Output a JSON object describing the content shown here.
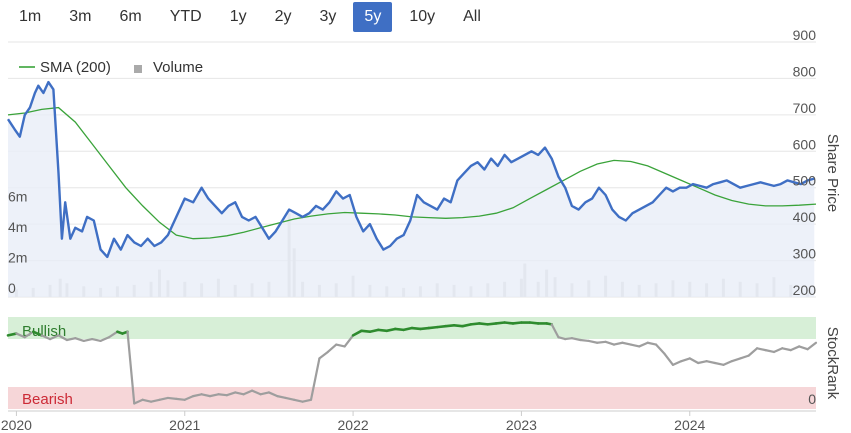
{
  "range_selector": {
    "buttons": [
      "1m",
      "3m",
      "6m",
      "YTD",
      "1y",
      "2y",
      "3y",
      "5y",
      "10y",
      "All"
    ],
    "active": "5y"
  },
  "colors": {
    "price": "#3f6fc4",
    "sma": "#3aa33a",
    "volume": "#cccccc",
    "stockrank": "#9e9e9e",
    "stockrank_bullish": "#2e8b2e",
    "bullish_band": "#d7efd7",
    "bearish_band": "#f6d6d8",
    "bullish_text": "#2e7d2e",
    "bearish_text": "#cc2a36"
  },
  "chart_data": [
    {
      "type": "line",
      "title": "",
      "ylabel": "Share Price",
      "ylim": [
        200,
        900
      ],
      "yticks": [
        "900",
        "800",
        "700",
        "600",
        "500",
        "400",
        "300",
        "200"
      ],
      "volume_ticks": [
        "6m",
        "4m",
        "2m",
        "0"
      ],
      "volume_ylim": [
        0,
        9
      ],
      "xlim": [
        2019.95,
        2024.75
      ],
      "xticks": [
        "2020",
        "2021",
        "2022",
        "2023",
        "2024"
      ],
      "legend": [
        "SMA (200)",
        "Volume"
      ],
      "legend_position": "top-left",
      "series": [
        {
          "name": "Price",
          "x": [
            2019.95,
            2019.99,
            2020.02,
            2020.05,
            2020.08,
            2020.11,
            2020.13,
            2020.16,
            2020.19,
            2020.22,
            2020.25,
            2020.27,
            2020.29,
            2020.32,
            2020.35,
            2020.39,
            2020.42,
            2020.46,
            2020.5,
            2020.54,
            2020.58,
            2020.62,
            2020.66,
            2020.7,
            2020.74,
            2020.78,
            2020.82,
            2020.86,
            2020.9,
            2020.95,
            2021.0,
            2021.05,
            2021.1,
            2021.14,
            2021.18,
            2021.22,
            2021.26,
            2021.3,
            2021.34,
            2021.38,
            2021.42,
            2021.46,
            2021.5,
            2021.54,
            2021.58,
            2021.62,
            2021.66,
            2021.7,
            2021.74,
            2021.78,
            2021.82,
            2021.86,
            2021.9,
            2021.94,
            2021.98,
            2022.02,
            2022.06,
            2022.1,
            2022.14,
            2022.18,
            2022.22,
            2022.26,
            2022.3,
            2022.34,
            2022.38,
            2022.42,
            2022.46,
            2022.5,
            2022.54,
            2022.58,
            2022.62,
            2022.66,
            2022.7,
            2022.74,
            2022.78,
            2022.82,
            2022.86,
            2022.9,
            2022.94,
            2022.98,
            2023.02,
            2023.06,
            2023.1,
            2023.14,
            2023.18,
            2023.22,
            2023.26,
            2023.3,
            2023.34,
            2023.38,
            2023.42,
            2023.46,
            2023.5,
            2023.54,
            2023.58,
            2023.62,
            2023.66,
            2023.7,
            2023.74,
            2023.78,
            2023.82,
            2023.86,
            2023.9,
            2023.94,
            2023.98,
            2024.02,
            2024.06,
            2024.1,
            2024.14,
            2024.18,
            2024.22,
            2024.26,
            2024.3,
            2024.34,
            2024.38,
            2024.42,
            2024.46,
            2024.5,
            2024.54,
            2024.58,
            2024.62,
            2024.66,
            2024.7,
            2024.74
          ],
          "values": [
            688,
            660,
            640,
            700,
            720,
            760,
            780,
            760,
            790,
            770,
            540,
            360,
            460,
            360,
            390,
            380,
            420,
            410,
            330,
            310,
            360,
            330,
            370,
            350,
            340,
            360,
            340,
            350,
            370,
            420,
            470,
            460,
            500,
            470,
            450,
            430,
            450,
            460,
            420,
            410,
            420,
            390,
            360,
            380,
            410,
            440,
            430,
            420,
            430,
            450,
            440,
            460,
            490,
            470,
            480,
            420,
            380,
            400,
            360,
            330,
            340,
            360,
            370,
            410,
            480,
            460,
            450,
            440,
            470,
            460,
            520,
            540,
            560,
            570,
            550,
            580,
            560,
            590,
            570,
            580,
            590,
            600,
            590,
            610,
            580,
            530,
            500,
            450,
            440,
            460,
            470,
            500,
            480,
            440,
            420,
            410,
            430,
            440,
            450,
            460,
            480,
            500,
            490,
            500,
            500,
            510,
            505,
            500,
            510,
            515,
            520,
            510,
            500,
            505,
            510,
            515,
            510,
            505,
            510,
            520,
            515,
            510,
            520,
            525
          ]
        },
        {
          "name": "SMA (200)",
          "x": [
            2019.95,
            2020.05,
            2020.15,
            2020.25,
            2020.35,
            2020.45,
            2020.55,
            2020.65,
            2020.75,
            2020.85,
            2020.95,
            2021.05,
            2021.15,
            2021.25,
            2021.35,
            2021.45,
            2021.55,
            2021.65,
            2021.75,
            2021.85,
            2021.95,
            2022.05,
            2022.15,
            2022.25,
            2022.35,
            2022.45,
            2022.55,
            2022.65,
            2022.75,
            2022.85,
            2022.95,
            2023.05,
            2023.15,
            2023.25,
            2023.35,
            2023.45,
            2023.55,
            2023.65,
            2023.75,
            2023.85,
            2023.95,
            2024.05,
            2024.15,
            2024.25,
            2024.35,
            2024.45,
            2024.55,
            2024.65,
            2024.75
          ],
          "values": [
            700,
            705,
            715,
            720,
            680,
            620,
            560,
            500,
            450,
            405,
            370,
            360,
            362,
            368,
            378,
            390,
            402,
            414,
            422,
            428,
            432,
            430,
            428,
            425,
            420,
            418,
            416,
            418,
            422,
            430,
            445,
            470,
            495,
            520,
            545,
            565,
            575,
            572,
            560,
            540,
            520,
            500,
            480,
            465,
            455,
            450,
            450,
            452,
            455
          ]
        },
        {
          "name": "Volume",
          "type": "bar",
          "x": [
            2020.0,
            2020.1,
            2020.2,
            2020.26,
            2020.3,
            2020.4,
            2020.5,
            2020.6,
            2020.7,
            2020.8,
            2020.85,
            2020.9,
            2021.0,
            2021.1,
            2021.2,
            2021.3,
            2021.4,
            2021.5,
            2021.62,
            2021.65,
            2021.7,
            2021.8,
            2021.9,
            2022.0,
            2022.1,
            2022.2,
            2022.3,
            2022.4,
            2022.5,
            2022.6,
            2022.7,
            2022.8,
            2022.9,
            2023.0,
            2023.02,
            2023.1,
            2023.15,
            2023.2,
            2023.3,
            2023.4,
            2023.5,
            2023.6,
            2023.7,
            2023.8,
            2023.9,
            2024.0,
            2024.1,
            2024.2,
            2024.3,
            2024.4,
            2024.5,
            2024.6,
            2024.7
          ],
          "values": [
            0.5,
            0.6,
            0.8,
            1.2,
            0.9,
            0.7,
            0.6,
            0.7,
            0.8,
            1.0,
            1.8,
            1.1,
            1.0,
            0.9,
            1.2,
            0.8,
            0.9,
            1.0,
            5.5,
            3.2,
            1.0,
            0.8,
            0.9,
            1.4,
            0.8,
            0.7,
            0.6,
            0.7,
            0.9,
            0.8,
            0.7,
            0.9,
            1.0,
            1.2,
            2.2,
            1.0,
            1.8,
            1.3,
            0.9,
            1.1,
            1.4,
            1.0,
            0.8,
            0.9,
            1.1,
            1.0,
            0.9,
            1.2,
            1.0,
            0.9,
            1.3,
            0.8,
            0.6
          ]
        }
      ]
    },
    {
      "type": "line",
      "title": "",
      "ylabel": "StockRank",
      "ylim": [
        0,
        100
      ],
      "yticks": [
        "100",
        "0"
      ],
      "bands": [
        "Bullish",
        "Bearish"
      ],
      "series": [
        {
          "name": "StockRank",
          "x": [
            2019.95,
            2020.0,
            2020.05,
            2020.1,
            2020.15,
            2020.2,
            2020.25,
            2020.3,
            2020.35,
            2020.4,
            2020.45,
            2020.5,
            2020.55,
            2020.6,
            2020.63,
            2020.66,
            2020.7,
            2020.75,
            2020.8,
            2020.85,
            2020.9,
            2020.95,
            2021.0,
            2021.05,
            2021.1,
            2021.15,
            2021.2,
            2021.25,
            2021.3,
            2021.35,
            2021.4,
            2021.45,
            2021.5,
            2021.55,
            2021.6,
            2021.65,
            2021.7,
            2021.75,
            2021.8,
            2021.85,
            2021.9,
            2021.95,
            2022.0,
            2022.05,
            2022.1,
            2022.15,
            2022.2,
            2022.25,
            2022.3,
            2022.35,
            2022.4,
            2022.45,
            2022.5,
            2022.55,
            2022.6,
            2022.65,
            2022.7,
            2022.75,
            2022.8,
            2022.85,
            2022.9,
            2022.95,
            2023.0,
            2023.05,
            2023.1,
            2023.15,
            2023.18,
            2023.22,
            2023.26,
            2023.3,
            2023.35,
            2023.4,
            2023.45,
            2023.5,
            2023.55,
            2023.6,
            2023.65,
            2023.7,
            2023.75,
            2023.8,
            2023.85,
            2023.9,
            2023.95,
            2024.0,
            2024.05,
            2024.1,
            2024.15,
            2024.2,
            2024.25,
            2024.3,
            2024.35,
            2024.4,
            2024.45,
            2024.5,
            2024.55,
            2024.6,
            2024.65,
            2024.7,
            2024.75
          ],
          "values": [
            80,
            82,
            78,
            84,
            80,
            76,
            80,
            75,
            77,
            74,
            76,
            74,
            78,
            84,
            82,
            84,
            6,
            10,
            8,
            10,
            12,
            11,
            10,
            14,
            16,
            14,
            16,
            15,
            18,
            16,
            20,
            16,
            18,
            14,
            12,
            10,
            8,
            10,
            55,
            62,
            70,
            68,
            80,
            85,
            84,
            86,
            85,
            87,
            86,
            88,
            87,
            88,
            89,
            90,
            91,
            90,
            92,
            93,
            92,
            93,
            94,
            93,
            94,
            94,
            93,
            93,
            92,
            78,
            76,
            77,
            75,
            74,
            72,
            73,
            70,
            72,
            70,
            68,
            72,
            70,
            60,
            48,
            52,
            55,
            50,
            52,
            50,
            48,
            52,
            55,
            58,
            66,
            64,
            62,
            66,
            64,
            68,
            65,
            72
          ]
        }
      ]
    }
  ]
}
